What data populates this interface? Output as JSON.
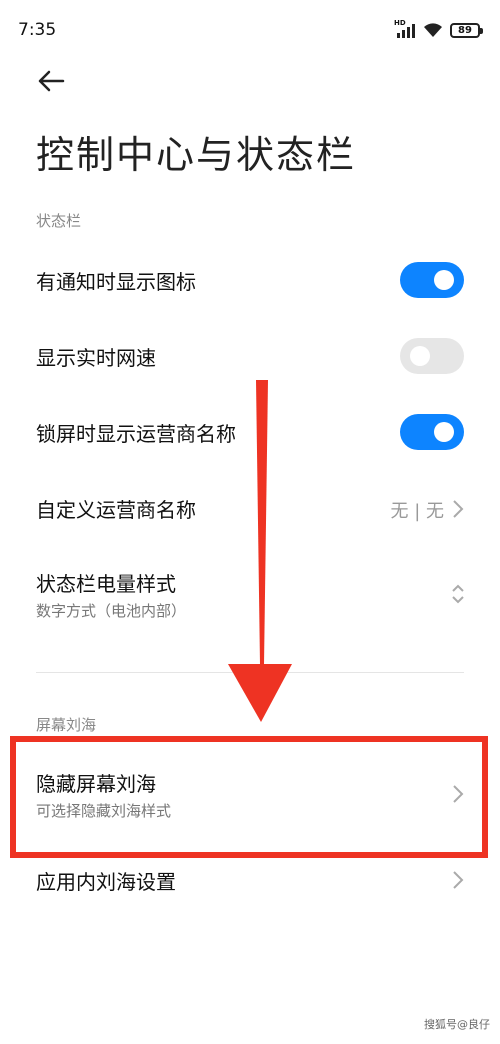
{
  "status_bar": {
    "time": "7:35",
    "network_label": "HD",
    "battery": "89"
  },
  "header": {
    "title": "控制中心与状态栏"
  },
  "sections": {
    "status_bar_header": "状态栏",
    "notch_header": "屏幕刘海"
  },
  "settings": {
    "notif_icons": {
      "label": "有通知时显示图标",
      "enabled": true
    },
    "net_speed": {
      "label": "显示实时网速",
      "enabled": false
    },
    "carrier_lock": {
      "label": "锁屏时显示运营商名称",
      "enabled": true
    },
    "custom_carrier": {
      "label": "自定义运营商名称",
      "value": "无 | 无"
    },
    "battery_style": {
      "label": "状态栏电量样式",
      "sublabel": "数字方式（电池内部）"
    },
    "hide_notch": {
      "label": "隐藏屏幕刘海",
      "sublabel": "可选择隐藏刘海样式"
    },
    "app_notch": {
      "label": "应用内刘海设置"
    }
  },
  "watermark": "搜狐号@良仔",
  "colors": {
    "toggle_on": "#0d84ff",
    "toggle_off": "#e6e6e6",
    "annotation_red": "#ee3323"
  }
}
